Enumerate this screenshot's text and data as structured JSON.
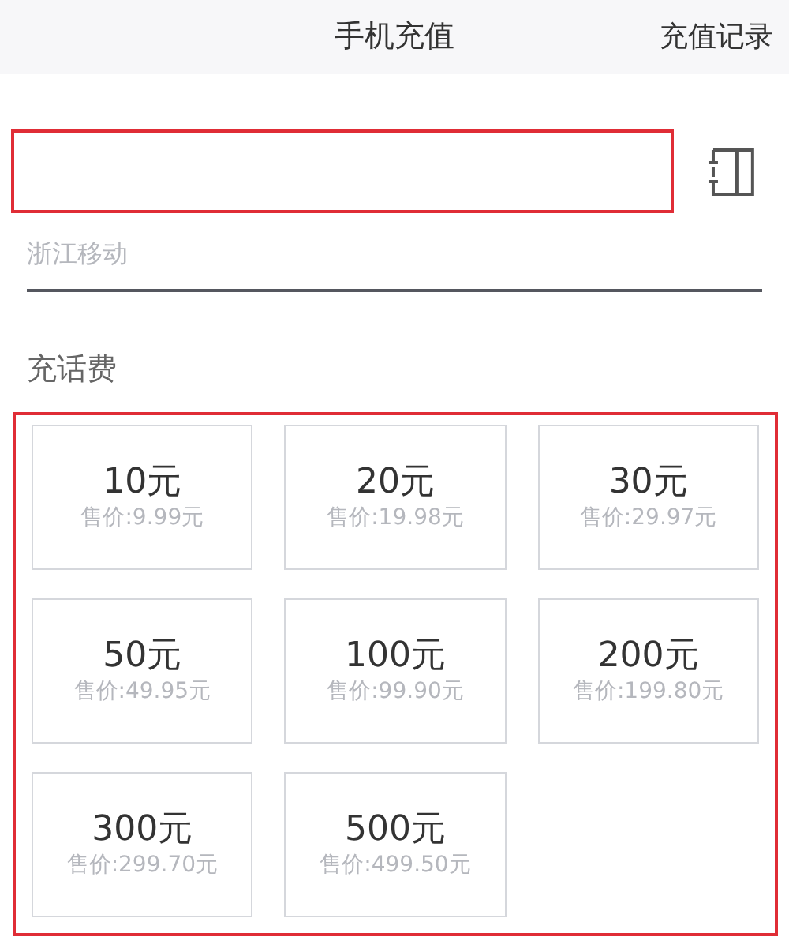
{
  "header": {
    "title": "手机充值",
    "action": "充值记录"
  },
  "phone_field": {
    "highlighted": true
  },
  "carrier": "浙江移动",
  "section_title": "充话费",
  "options_highlighted": true,
  "options": [
    {
      "amount": "10元",
      "price": "售价:9.99元"
    },
    {
      "amount": "20元",
      "price": "售价:19.98元"
    },
    {
      "amount": "30元",
      "price": "售价:29.97元"
    },
    {
      "amount": "50元",
      "price": "售价:49.95元"
    },
    {
      "amount": "100元",
      "price": "售价:99.90元"
    },
    {
      "amount": "200元",
      "price": "售价:199.80元"
    },
    {
      "amount": "300元",
      "price": "售价:299.70元"
    },
    {
      "amount": "500元",
      "price": "售价:499.50元"
    }
  ]
}
